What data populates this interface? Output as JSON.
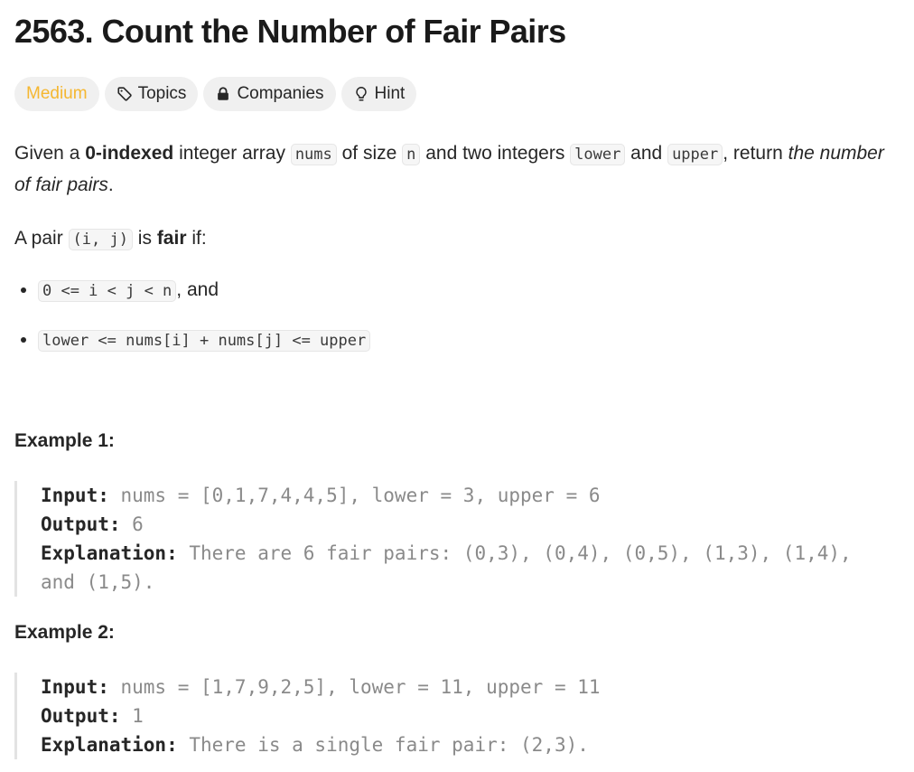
{
  "problem": {
    "title": "2563. Count the Number of Fair Pairs",
    "tags": {
      "difficulty": "Medium",
      "topics": "Topics",
      "companies": "Companies",
      "hint": "Hint"
    },
    "description": {
      "p1_given": "Given a ",
      "p1_bold": "0-indexed",
      "p1_after_bold": " integer array ",
      "p1_code_nums": "nums",
      "p1_of_size": " of size ",
      "p1_code_n": "n",
      "p1_two_ints": " and two integers ",
      "p1_code_lower": "lower",
      "p1_and": " and ",
      "p1_code_upper": "upper",
      "p1_return": ", return ",
      "p1_italic": "the number of fair pairs",
      "p1_end": ".",
      "p2_pair": "A pair ",
      "p2_code": "(i, j)",
      "p2_is": " is ",
      "p2_bold": "fair",
      "p2_if": " if:",
      "cond1_code": "0 <= i < j < n",
      "cond1_tail": ", and",
      "cond2_code": "lower <= nums[i] + nums[j] <= upper"
    },
    "examples": [
      {
        "title": "Example 1:",
        "input_label": "Input:",
        "input_value": " nums = [0,1,7,4,4,5], lower = 3, upper = 6",
        "output_label": "Output:",
        "output_value": " 6",
        "explanation_label": "Explanation:",
        "explanation_value": " There are 6 fair pairs: (0,3), (0,4), (0,5), (1,3), (1,4), and (1,5)."
      },
      {
        "title": "Example 2:",
        "input_label": "Input:",
        "input_value": " nums = [1,7,9,2,5], lower = 11, upper = 11",
        "output_label": "Output:",
        "output_value": " 1",
        "explanation_label": "Explanation:",
        "explanation_value": " There is a single fair pair: (2,3)."
      }
    ],
    "colors": {
      "difficulty_medium": "#f5b731",
      "tag_bg": "#f0f0f0",
      "text": "#262626",
      "muted": "#8a8a8a"
    },
    "icons": {
      "topics": "tag-icon",
      "companies": "lock-icon",
      "hint": "lightbulb-icon"
    }
  }
}
